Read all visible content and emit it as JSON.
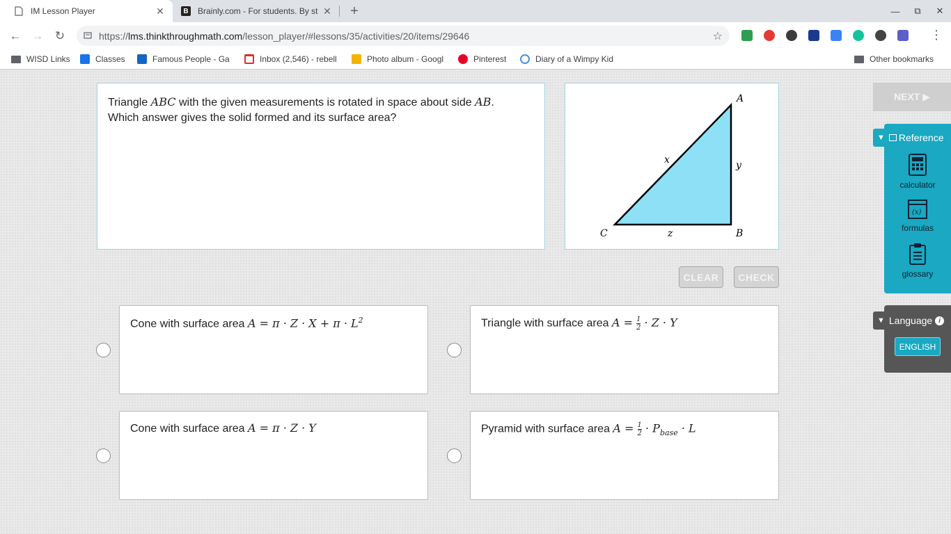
{
  "browser": {
    "tabs": [
      {
        "title": "IM Lesson Player"
      },
      {
        "title": "Brainly.com - For students. By st"
      }
    ],
    "url": {
      "prefix": "https://",
      "host": "lms.thinkthroughmath.com",
      "path": "/lesson_player/#lessons/35/activities/20/items/29646"
    },
    "bookmarks": [
      {
        "label": "WISD Links",
        "icon": "folder-icon"
      },
      {
        "label": "Classes",
        "icon": "classroom-icon"
      },
      {
        "label": "Famous People - Ga",
        "icon": "gap-icon"
      },
      {
        "label": "Inbox (2,546) - rebell",
        "icon": "gmail-icon"
      },
      {
        "label": "Photo album - Googl",
        "icon": "slides-icon"
      },
      {
        "label": "Pinterest",
        "icon": "pinterest-icon"
      },
      {
        "label": "Diary of a Wimpy Kid",
        "icon": "globe-icon"
      }
    ],
    "other_bookmarks": "Other bookmarks",
    "colors": {
      "tabstrip": "#dee1e6",
      "accent": "#1aa8c2"
    }
  },
  "question": {
    "text_1": "Triangle ",
    "math_abc": "ABC",
    "text_2": " with the given measurements is rotated in space about side ",
    "math_ab": "AB",
    "text_3": ".",
    "line_2": "Which answer gives the solid formed and its surface area?"
  },
  "figure": {
    "vertices": {
      "a": "A",
      "b": "B",
      "c": "C"
    },
    "sides": {
      "x": "x",
      "y": "y",
      "z": "z"
    },
    "fill_color": "#8ee0f6"
  },
  "buttons": {
    "clear": "CLEAR",
    "check": "CHECK",
    "next": "NEXT ▶"
  },
  "answers": [
    {
      "text": "Cone with surface area ",
      "formula": "A = π · Z · X + π · L",
      "sup": "2"
    },
    {
      "text": "Triangle with surface area ",
      "formula_pre": "A = ",
      "frac_num": "1",
      "frac_den": "2",
      "formula_post": " · Z · Y"
    },
    {
      "text": "Cone with surface area ",
      "formula": "A = π · Z · Y"
    },
    {
      "text": "Pyramid with surface area ",
      "formula_pre": "A = ",
      "frac_num": "1",
      "frac_den": "2",
      "formula_mid": " · P",
      "sub": "base",
      "formula_post": " · L"
    }
  ],
  "sidebar": {
    "reference_label": "Reference",
    "items": [
      {
        "label": "calculator",
        "icon": "calculator-icon"
      },
      {
        "label": "formulas",
        "icon": "formulas-icon"
      },
      {
        "label": "glossary",
        "icon": "clipboard-icon"
      }
    ],
    "language_label": "Language",
    "language_value": "ENGLISH"
  }
}
